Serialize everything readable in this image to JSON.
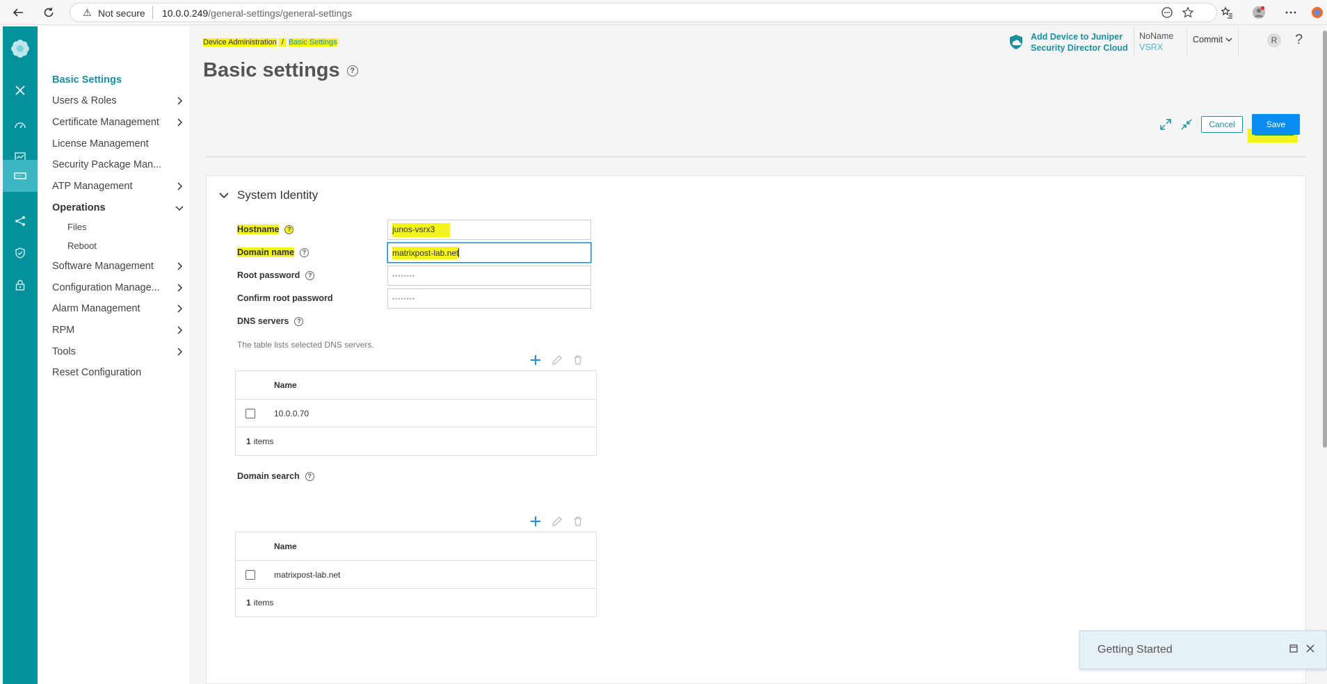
{
  "browser": {
    "security_label": "Not secure",
    "url_host": "10.0.0.249",
    "url_path": "/general-settings/general-settings"
  },
  "breadcrumb": {
    "parent": "Device Administration",
    "separator": "/",
    "current": "Basic Settings"
  },
  "page": {
    "title": "Basic settings"
  },
  "header": {
    "sd_line1": "Add Device to Juniper",
    "sd_line2": "Security Director Cloud",
    "host_name": "NoName",
    "host_type": "VSRX",
    "commit_label": "Commit",
    "avatar_initial": "R",
    "help": "?"
  },
  "toolbar": {
    "cancel_label": "Cancel",
    "save_label": "Save"
  },
  "nav": {
    "items": [
      {
        "label": "Basic Settings"
      },
      {
        "label": "Users & Roles"
      },
      {
        "label": "Certificate Management"
      },
      {
        "label": "License Management"
      },
      {
        "label": "Security Package Man..."
      },
      {
        "label": "ATP Management"
      },
      {
        "label": "Operations"
      },
      {
        "label": "Files"
      },
      {
        "label": "Reboot"
      },
      {
        "label": "Software Management"
      },
      {
        "label": "Configuration Manage..."
      },
      {
        "label": "Alarm Management"
      },
      {
        "label": "RPM"
      },
      {
        "label": "Tools"
      },
      {
        "label": "Reset Configuration"
      }
    ]
  },
  "section": {
    "title": "System Identity",
    "hostname": {
      "label": "Hostname",
      "value": "junos-vsrx3"
    },
    "domain_name": {
      "label": "Domain name",
      "value": "matrixpost-lab.net"
    },
    "root_password": {
      "label": "Root password",
      "value": "••••••••"
    },
    "confirm_root_password": {
      "label": "Confirm root password",
      "value": "••••••••"
    },
    "dns": {
      "label": "DNS servers",
      "hint": "The table lists selected DNS servers.",
      "column": "Name",
      "rows": [
        "10.0.0.70"
      ],
      "count": "1",
      "count_suffix": "items"
    },
    "domain_search": {
      "label": "Domain search",
      "column": "Name",
      "rows": [
        "matrixpost-lab.net"
      ],
      "count": "1",
      "count_suffix": "items"
    }
  },
  "getting_started": {
    "title": "Getting Started"
  },
  "colors": {
    "rail": "#05919c",
    "accent": "#1b8fa0",
    "save": "#0a8cf0",
    "highlight": "#f3f31f"
  }
}
